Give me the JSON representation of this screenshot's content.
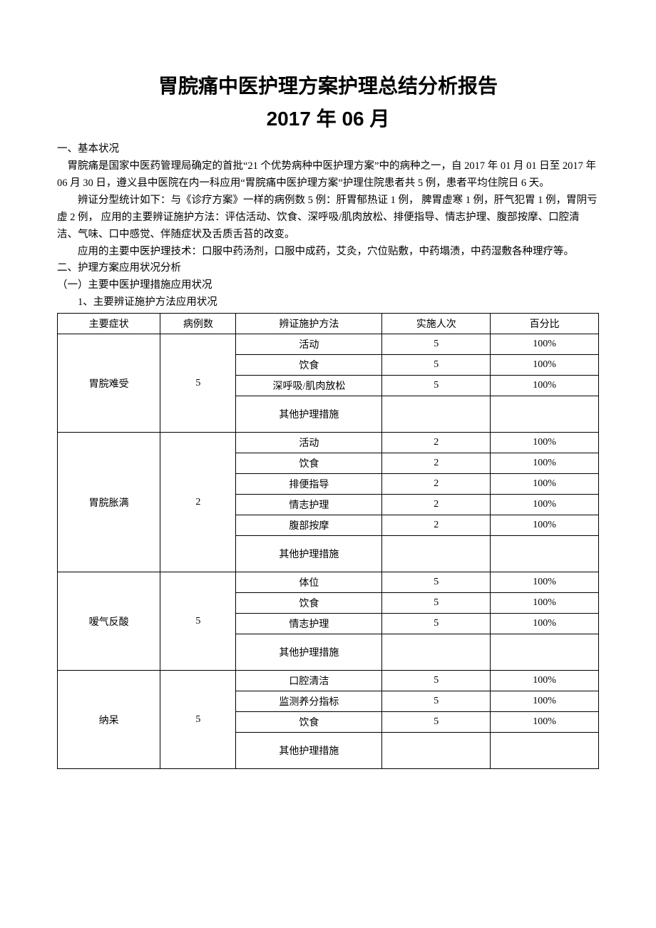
{
  "title": "胃脘痛中医护理方案护理总结分析报告",
  "subtitle": "2017 年 06 月",
  "section1_heading": "一、基本状况",
  "para1": "胃脘痛是国家中医药管理局确定的首批“21 个优势病种中医护理方案”中的病种之一，自 2017 年 01 月 01 日至 2017 年 06 月 30 日，遵义县中医院在内一科应用“胃脘痛中医护理方案”护理住院患者共 5 例，患者平均住院日 6 天。",
  "para2": "辨证分型统计如下：与《诊疗方案》一样的病例数 5 例：肝胃郁热证 1 例，  脾胃虚寒 1 例，肝气犯胃 1 例，胃阴亏虚 2 例，  应用的主要辨证施护方法：评估活动、饮食、深呼吸/肌肉放松、排便指导、情志护理、腹部按摩、口腔清洁、气味、口中感觉、伴随症状及舌质舌苔的改变。",
  "para3": "应用的主要中医护理技术：口服中药汤剂，口服中成药，艾灸，穴位贴敷，中药塌渍，中药湿敷各种理疗等。",
  "section2_heading": "二、护理方案应用状况分析",
  "section2_sub1": "（一）主要中医护理措施应用状况",
  "section2_sub1_1": "1、主要辨证施护方法应用状况",
  "table": {
    "headers": {
      "c1": "主要症状",
      "c2": "病例数",
      "c3": "辨证施护方法",
      "c4": "实施人次",
      "c5": "百分比"
    },
    "groups": [
      {
        "symptom": "胃脘难受",
        "cases": "5",
        "rows": [
          {
            "method": "活动",
            "count": "5",
            "pct": "100%"
          },
          {
            "method": "饮食",
            "count": "5",
            "pct": "100%"
          },
          {
            "method": "深呼吸/肌肉放松",
            "count": "5",
            "pct": "100%"
          },
          {
            "method": "其他护理措施",
            "count": "",
            "pct": "",
            "tall": true
          }
        ]
      },
      {
        "symptom": "胃脘胀满",
        "cases": "2",
        "rows": [
          {
            "method": "活动",
            "count": "2",
            "pct": "100%"
          },
          {
            "method": "饮食",
            "count": "2",
            "pct": "100%"
          },
          {
            "method": "排便指导",
            "count": "2",
            "pct": "100%"
          },
          {
            "method": "情志护理",
            "count": "2",
            "pct": "100%"
          },
          {
            "method": "腹部按摩",
            "count": "2",
            "pct": "100%"
          },
          {
            "method": "其他护理措施",
            "count": "",
            "pct": "",
            "tall": true
          }
        ]
      },
      {
        "symptom": "嗳气反酸",
        "cases": "5",
        "rows": [
          {
            "method": "体位",
            "count": "5",
            "pct": "100%"
          },
          {
            "method": "饮食",
            "count": "5",
            "pct": "100%"
          },
          {
            "method": "情志护理",
            "count": "5",
            "pct": "100%"
          },
          {
            "method": "其他护理措施",
            "count": "",
            "pct": "",
            "tall": true
          }
        ]
      },
      {
        "symptom": "纳呆",
        "cases": "5",
        "rows": [
          {
            "method": "口腔清洁",
            "count": "5",
            "pct": "100%"
          },
          {
            "method": "监测养分指标",
            "count": "5",
            "pct": "100%"
          },
          {
            "method": "饮食",
            "count": "5",
            "pct": "100%"
          },
          {
            "method": "其他护理措施",
            "count": "",
            "pct": "",
            "tall": true
          }
        ]
      }
    ]
  }
}
